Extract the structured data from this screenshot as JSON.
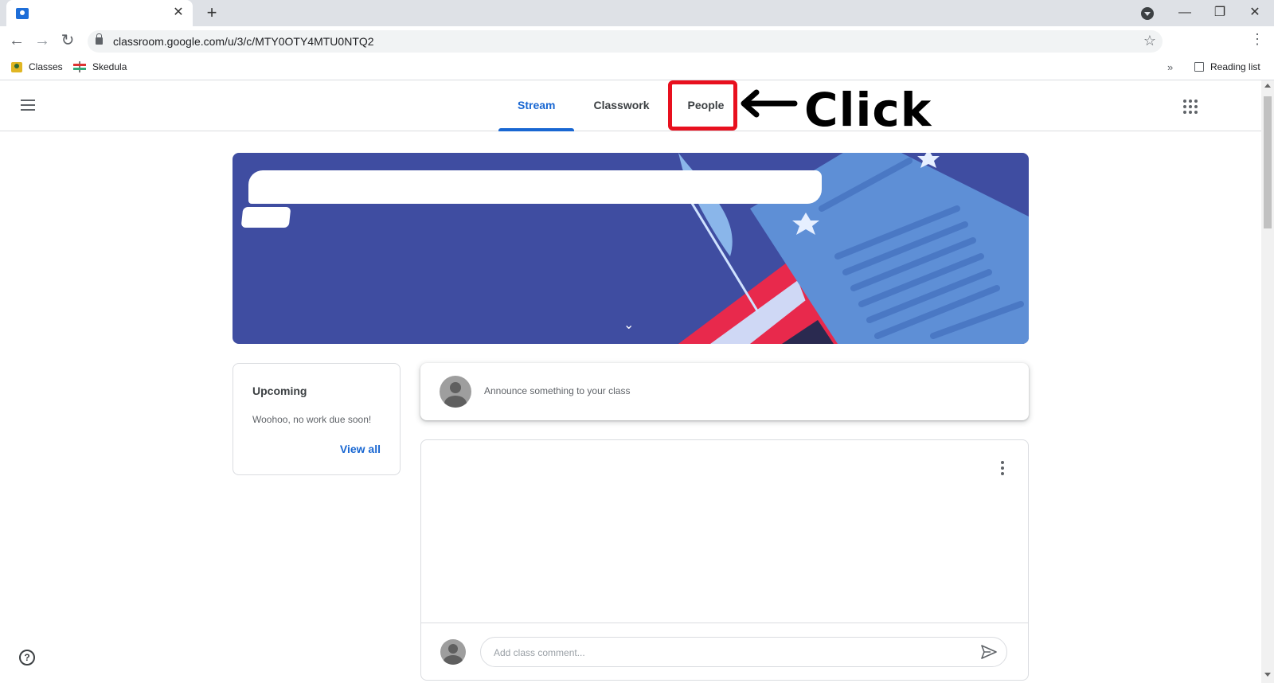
{
  "browser": {
    "tab_close": "✕",
    "new_tab": "+",
    "url": "classroom.google.com/u/3/c/MTY0OTY4MTU0NTQ2",
    "bookmarks": [
      {
        "label": "Classes"
      },
      {
        "label": "Skedula"
      }
    ],
    "bookmarks_more": "»",
    "reading_list": "Reading list",
    "window_controls": {
      "minimize": "—",
      "restore": "❐",
      "close": "✕"
    }
  },
  "header": {
    "tabs": [
      {
        "label": "Stream",
        "active": true
      },
      {
        "label": "Classwork",
        "active": false
      },
      {
        "label": "People",
        "active": false
      }
    ]
  },
  "annotation": {
    "text": "Click",
    "highlight_color": "#e8101e"
  },
  "upcoming": {
    "title": "Upcoming",
    "empty_text": "Woohoo, no work due soon!",
    "view_all": "View all"
  },
  "announce": {
    "placeholder": "Announce something to your class"
  },
  "post": {
    "comment_placeholder": "Add class comment..."
  },
  "colors": {
    "accent": "#1967d2",
    "banner": "#3f4da1"
  },
  "icons": {
    "help": "?"
  }
}
